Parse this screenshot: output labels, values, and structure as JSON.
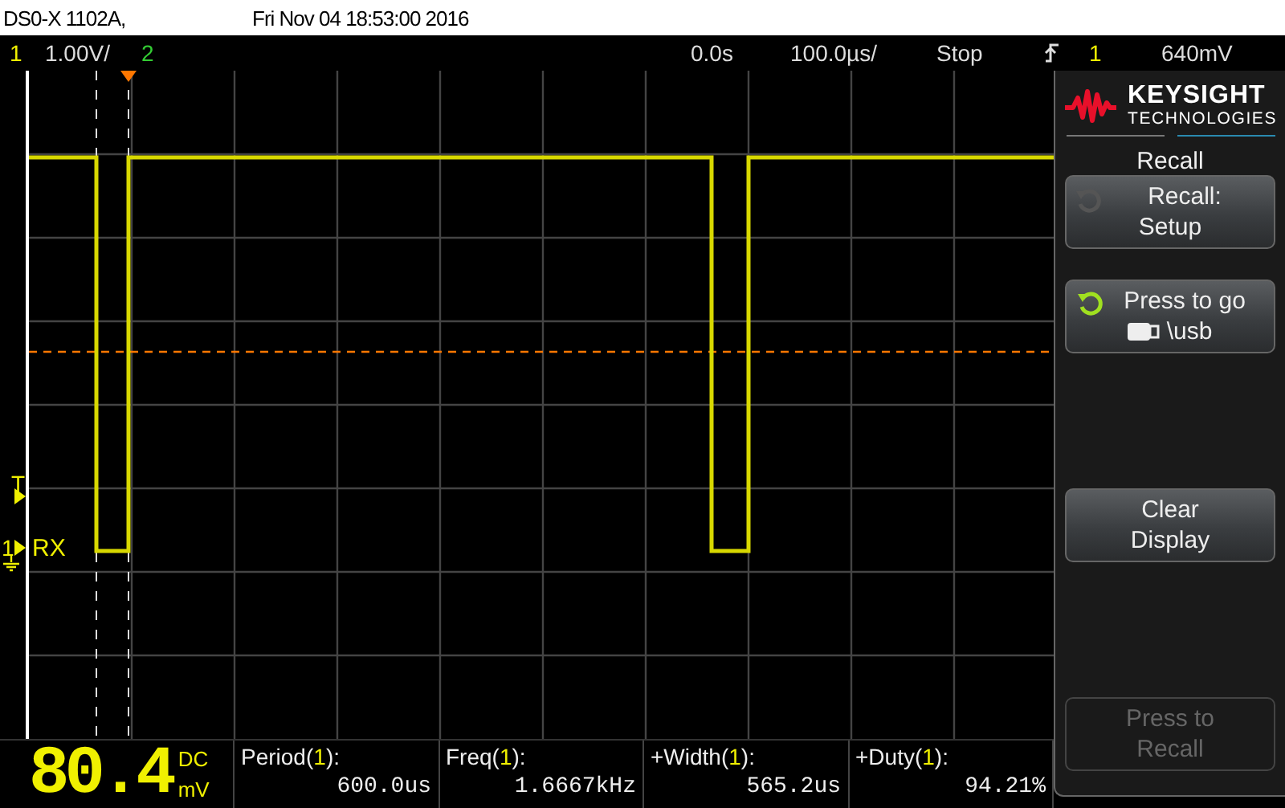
{
  "title": "DS0-X 1102A,",
  "timestamp": "Fri Nov 04 18:53:00 2016",
  "channels": [
    {
      "number": "1",
      "scale": "1.00V/",
      "color": "#f0f000"
    },
    {
      "number": "2",
      "color": "#33cc33"
    }
  ],
  "horizontal": {
    "delay": "0.0s",
    "timebase": "100.0µs/"
  },
  "run_state": "Stop",
  "trigger": {
    "source": "1",
    "level": "640mV"
  },
  "markers": {
    "trigger_label": "T",
    "channel_label": "1",
    "signal_label": "RX"
  },
  "brand": {
    "name": "KEYSIGHT",
    "tagline": "TECHNOLOGIES"
  },
  "menu": {
    "title": "Recall",
    "softkeys": [
      {
        "kind": "action",
        "lines": [
          "Recall:",
          "Setup"
        ],
        "icon_active": false,
        "disabled": false
      },
      {
        "kind": "path",
        "lines": [
          "Press to go",
          "\\usb"
        ],
        "icon_active": true,
        "disabled": false
      },
      {
        "kind": "blank"
      },
      {
        "kind": "plain",
        "lines": [
          "Clear",
          "Display"
        ],
        "disabled": false
      },
      {
        "kind": "blank"
      },
      {
        "kind": "plain",
        "lines": [
          "Press to",
          "Recall"
        ],
        "disabled": true
      }
    ]
  },
  "readout": {
    "value": "80.4",
    "coupling": "DC",
    "unit": "mV"
  },
  "measurements": [
    {
      "name": "Period(",
      "channel": "1",
      "end": "):",
      "value": "600.0us"
    },
    {
      "name": "Freq(",
      "channel": "1",
      "end": "):",
      "value": "1.6667kHz"
    },
    {
      "name": "+Width(",
      "channel": "1",
      "end": "):",
      "value": "565.2us"
    },
    {
      "name": "+Duty(",
      "channel": "1",
      "end": "):",
      "value": "94.21%"
    }
  ]
}
